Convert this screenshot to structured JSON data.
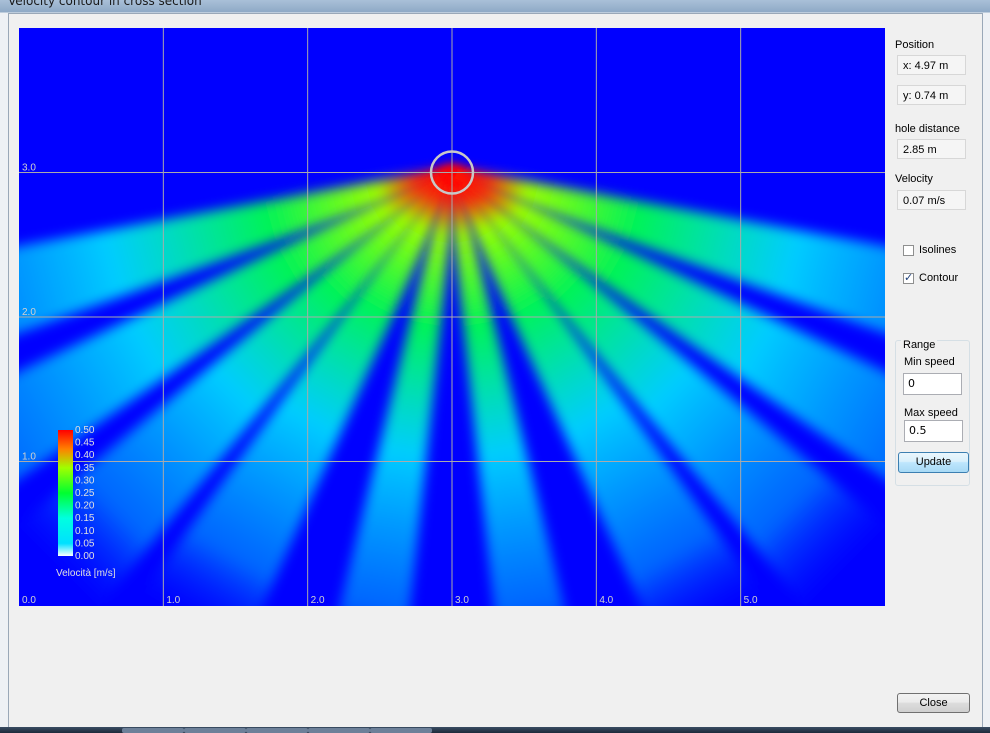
{
  "window": {
    "title": "Velocity contour in cross section"
  },
  "position": {
    "label": "Position",
    "x": "x: 4.97 m",
    "y": "y: 0.74 m"
  },
  "hole_distance": {
    "label": "hole distance",
    "value": "2.85 m"
  },
  "velocity": {
    "label": "Velocity",
    "value": "0.07 m/s"
  },
  "options": {
    "isolines_label": "Isolines",
    "isolines_checked": false,
    "contour_label": "Contour",
    "contour_checked": true
  },
  "range": {
    "label": "Range",
    "min_label": "Min speed",
    "min_value": "0",
    "max_label": "Max speed",
    "max_value": "0.5",
    "update_label": "Update"
  },
  "close_label": "Close",
  "colors": {
    "background": "#0000ff",
    "low": "#00e6ff",
    "mid": "#00ff40",
    "high": "#ff0000",
    "grid": "#aaaaaa"
  },
  "chart_data": {
    "type": "heatmap",
    "title": "",
    "xlabel": "",
    "ylabel": "",
    "x_ticks": [
      "0.0",
      "1.0",
      "2.0",
      "3.0",
      "4.0",
      "5.0"
    ],
    "y_ticks": [
      "1.0",
      "2.0",
      "3.0"
    ],
    "xlim": [
      0,
      6
    ],
    "ylim": [
      0,
      4
    ],
    "source": {
      "x": 3.0,
      "y": 3.0
    },
    "jets_angle_deg": [
      -75,
      -60,
      -45,
      -30,
      -10,
      10,
      30,
      45,
      60,
      75
    ],
    "colorbar": {
      "title": "Velocità [m/s]",
      "ticks": [
        "0.50",
        "0.45",
        "0.40",
        "0.35",
        "0.30",
        "0.25",
        "0.20",
        "0.15",
        "0.10",
        "0.05",
        "0.00"
      ],
      "range": [
        0,
        0.5
      ]
    }
  }
}
